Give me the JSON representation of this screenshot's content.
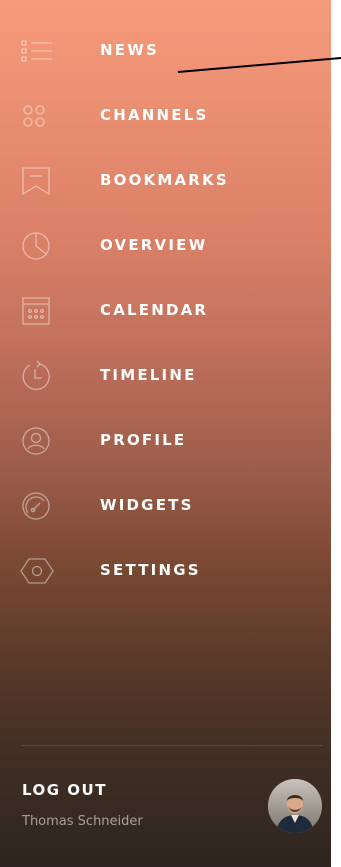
{
  "menu": {
    "items": [
      {
        "label": "NEWS",
        "icon": "list-icon"
      },
      {
        "label": "CHANNELS",
        "icon": "grid-dots-icon"
      },
      {
        "label": "BOOKMARKS",
        "icon": "bookmark-icon"
      },
      {
        "label": "OVERVIEW",
        "icon": "pie-chart-icon"
      },
      {
        "label": "CALENDAR",
        "icon": "calendar-icon"
      },
      {
        "label": "TIMELINE",
        "icon": "clock-history-icon"
      },
      {
        "label": "PROFILE",
        "icon": "user-icon"
      },
      {
        "label": "WIDGETS",
        "icon": "gauge-icon"
      },
      {
        "label": "SETTINGS",
        "icon": "hexagon-gear-icon"
      }
    ]
  },
  "footer": {
    "logout_label": "LOG OUT",
    "user_name": "Thomas Schneider"
  },
  "colors": {
    "gradient_top": "#f79a7c",
    "gradient_bottom": "#2e2520",
    "text": "#ffffff"
  }
}
